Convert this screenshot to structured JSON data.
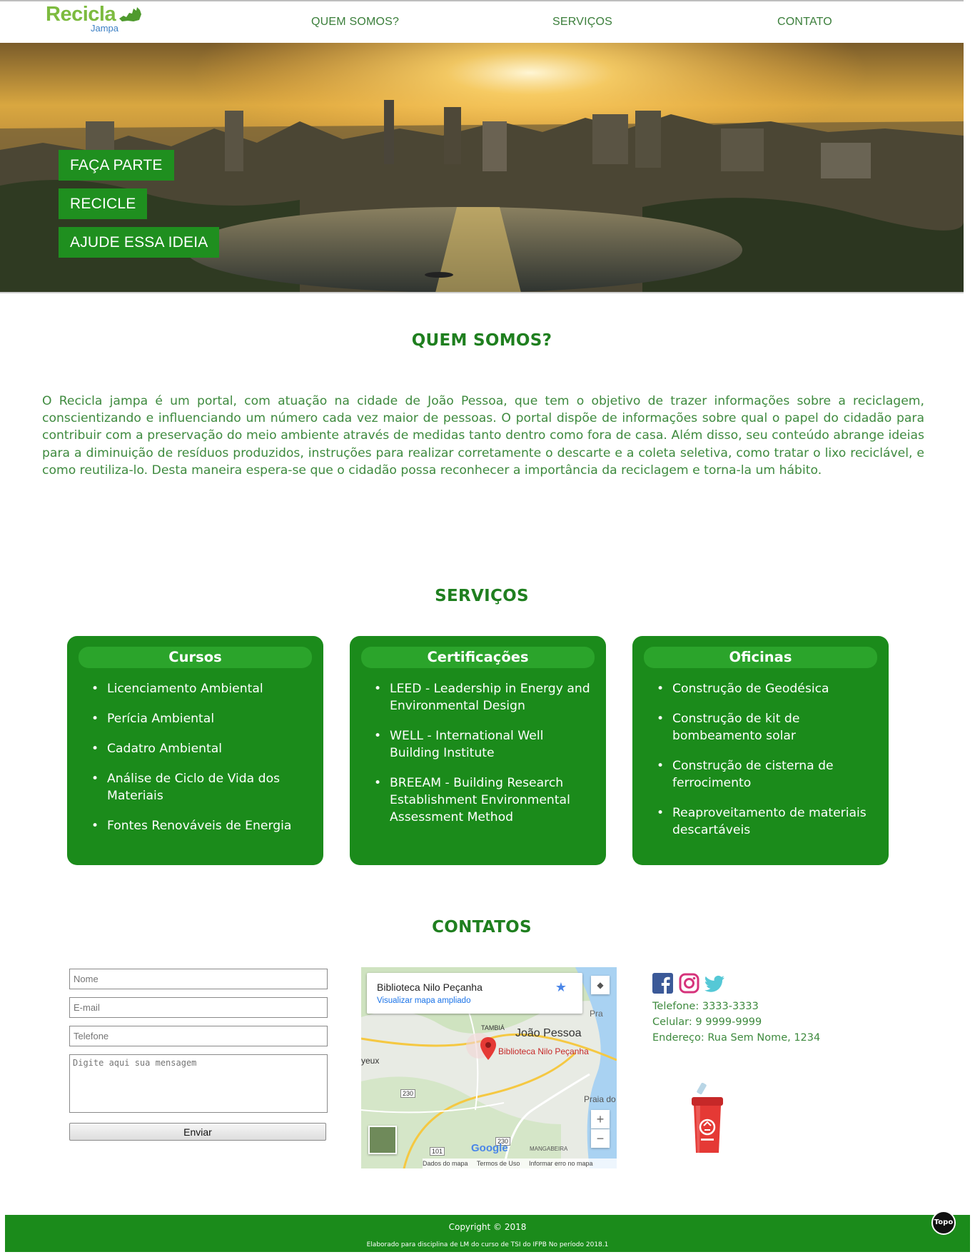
{
  "brand": {
    "name": "Recicla",
    "sub": "Jampa",
    "green": "#7dbb3f",
    "blue": "#3b7fc4"
  },
  "nav": [
    "QUEM SOMOS?",
    "SERVIÇOS",
    "CONTATO"
  ],
  "hero": {
    "buttons": [
      "FAÇA PARTE",
      "RECICLE",
      "AJUDE ESSA IDEIA"
    ]
  },
  "about": {
    "title": "QUEM SOMOS?",
    "text": "O Recicla jampa é um portal, com atuação na cidade de João Pessoa, que tem o objetivo de trazer informações sobre a reciclagem, conscientizando e influenciando um número cada vez maior de pessoas. O portal dispõe de informações sobre qual o papel do cidadão para contribuir com a preservação do meio ambiente através de medidas tanto dentro como fora de casa. Além disso, seu conteúdo abrange ideias para a diminuição de resíduos produzidos, instruções para realizar corretamente o descarte e a coleta seletiva, como tratar o lixo reciclável, e como reutiliza-lo. Desta maneira espera-se que o cidadão possa reconhecer a importância da reciclagem e torna-la um hábito."
  },
  "services": {
    "title": "SERVIÇOS",
    "cards": [
      {
        "title": "Cursos",
        "items": [
          "Licenciamento Ambiental",
          "Perícia Ambiental",
          "Cadatro Ambiental",
          "Análise de Ciclo de Vida dos Materiais",
          "Fontes Renováveis de Energia"
        ]
      },
      {
        "title": "Certificações",
        "items": [
          "LEED - Leadership in Energy and Environmental Design",
          "WELL - International Well Building Institute",
          "BREEAM - Building Research Establishment Environmental Assessment Method"
        ]
      },
      {
        "title": "Oficinas",
        "items": [
          "Construção de Geodésica",
          "Construção de kit de bombeamento solar",
          "Construção de cisterna de ferrocimento",
          "Reaproveitamento de materiais descartáveis"
        ]
      }
    ]
  },
  "contacts": {
    "title": "CONTATOS",
    "form": {
      "name_placeholder": "Nome",
      "email_placeholder": "E-mail",
      "phone_placeholder": "Telefone",
      "message_placeholder": "Digite aqui sua mensagem",
      "send_label": "Enviar"
    },
    "map": {
      "place": "Biblioteca Nilo Peçanha",
      "link": "Visualizar mapa ampliado",
      "city": "João Pessoa",
      "pin_label": "Biblioteca Nilo Peçanha",
      "labels": {
        "tambia": "TAMBIÁ",
        "praia": "Praia do",
        "pra": "Pra",
        "yeux": "yeux",
        "mangabeira": "MANGABEIRA",
        "road1": "230",
        "road2": "230",
        "road3": "101",
        "google": "Google"
      },
      "footer": [
        "Dados do mapa",
        "Termos de Uso",
        "Informar erro no mapa"
      ],
      "zoom_in": "+",
      "zoom_out": "−"
    },
    "phone": "Telefone: 3333-3333",
    "mobile": "Celular: 9 9999-9999",
    "address": "Endereço: Rua Sem Nome, 1234",
    "social": [
      "facebook-icon",
      "instagram-icon",
      "twitter-icon"
    ]
  },
  "footer": {
    "copyright": "Copyright © 2018",
    "made_for": "Elaborado para disciplina de LM do curso de TSI do IFPB No período 2018.1",
    "top_label": "Topo",
    "color": "#1b8b1b"
  }
}
